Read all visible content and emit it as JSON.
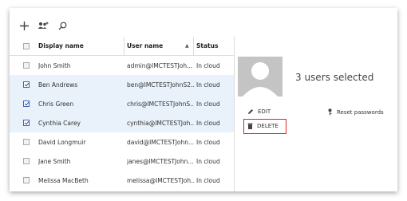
{
  "toolbar": {
    "add_icon": "plus-icon",
    "multi_icon": "add-multiple-users-icon",
    "search_icon": "search-icon"
  },
  "table": {
    "columns": [
      "Display name",
      "User name",
      "Status"
    ],
    "sort_column": "User name",
    "sort_direction": "ascending",
    "rows": [
      {
        "name": "John Smith",
        "user": "admin@IMCTESTJoh...",
        "status": "In cloud",
        "checked": false
      },
      {
        "name": "Ben Andrews",
        "user": "ben@IMCTESTJohnS2...",
        "status": "In cloud",
        "checked": true
      },
      {
        "name": "Chris Green",
        "user": "chris@IMCTESTJohnS...",
        "status": "In cloud",
        "checked": true
      },
      {
        "name": "Cynthia Carey",
        "user": "cynthia@IMCTESTJoh...",
        "status": "In cloud",
        "checked": true
      },
      {
        "name": "David Longmuir",
        "user": "david@IMCTESTJohn...",
        "status": "In cloud",
        "checked": false
      },
      {
        "name": "Jane Smith",
        "user": "janes@IMCTESTJohn...",
        "status": "In cloud",
        "checked": false
      },
      {
        "name": "Melissa MacBeth",
        "user": "melissa@IMCTESTJoh...",
        "status": "In cloud",
        "checked": false
      }
    ]
  },
  "detail": {
    "title": "3 users selected",
    "actions": {
      "edit": "EDIT",
      "reset": "Reset passwords",
      "delete": "DELETE"
    }
  },
  "colors": {
    "selection_bg": "#e9f1fa",
    "highlight": "#d8261f",
    "avatar_bg": "#c4c4c4"
  }
}
